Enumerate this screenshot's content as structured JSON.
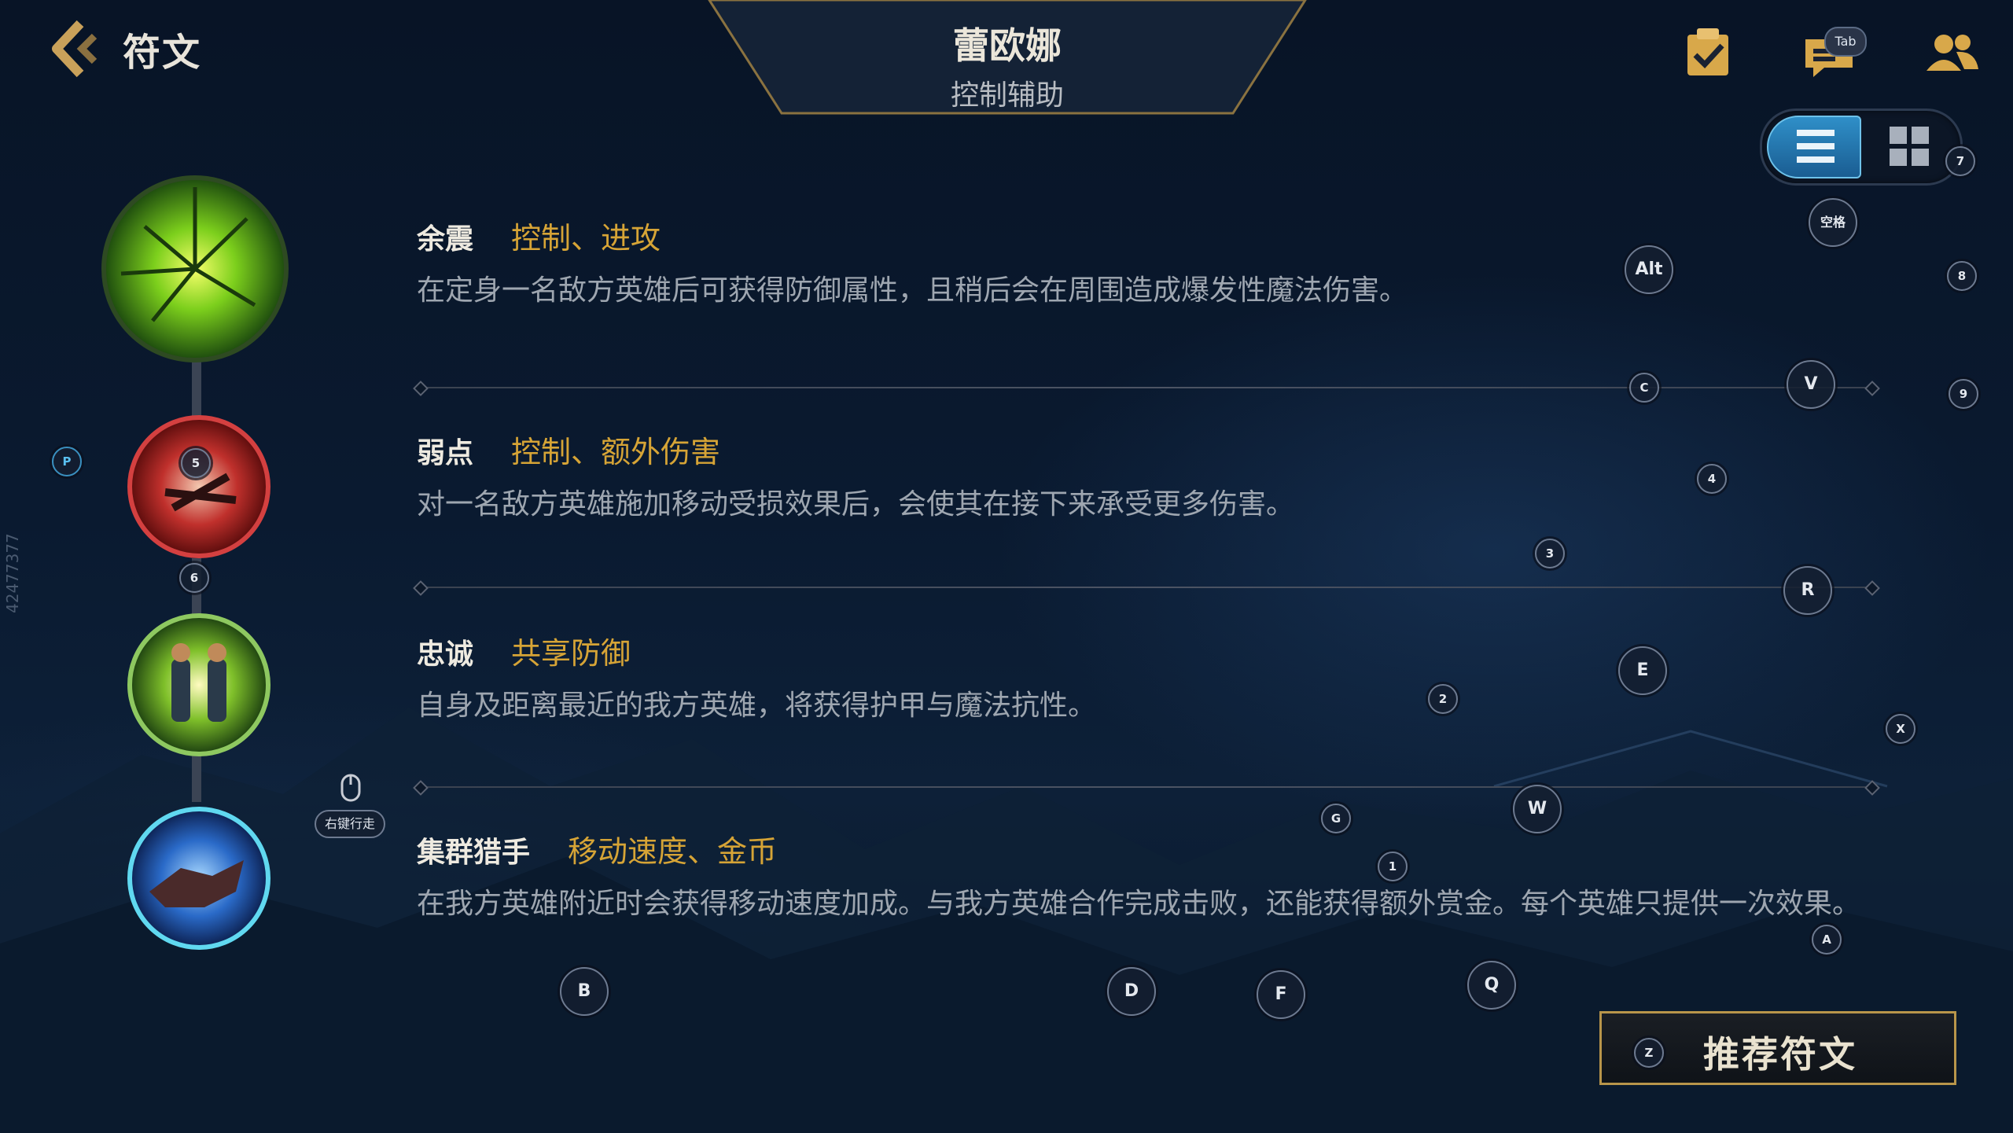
{
  "header": {
    "back_title": "符文",
    "champion_name": "蕾欧娜",
    "champion_role": "控制辅助",
    "tab_badge": "Tab"
  },
  "colors": {
    "tag_gold": "#d6a436",
    "accent_blue": "#2f8fc8",
    "button_border": "#b8954a"
  },
  "runes": [
    {
      "name": "余震",
      "tags": "控制、进攻",
      "desc": "在定身一名敌方英雄后可获得防御属性，且稍后会在周围造成爆发性魔法伤害。",
      "icon": "aftershock-icon"
    },
    {
      "name": "弱点",
      "tags": "控制、额外伤害",
      "desc": "对一名敌方英雄施加移动受损效果后，会使其在接下来承受更多伤害。",
      "icon": "weakness-icon"
    },
    {
      "name": "忠诚",
      "tags": "共享防御",
      "desc": "自身及距离最近的我方英雄，将获得护甲与魔法抗性。",
      "icon": "loyalty-icon"
    },
    {
      "name": "集群猎手",
      "tags": "移动速度、金币",
      "desc": "在我方英雄附近时会获得移动速度加成。与我方英雄合作完成击败，还能获得额外赏金。每个英雄只提供一次效果。",
      "icon": "pack-hunter-icon"
    }
  ],
  "recommend_button": "推荐符文",
  "right_click_hint": "右键行走",
  "side_id": "42477377",
  "keys": {
    "p": "P",
    "alt": "Alt",
    "space": "空格",
    "seven": "7",
    "eight": "8",
    "nine": "9",
    "c": "C",
    "v": "V",
    "four": "4",
    "five": "5",
    "six": "6",
    "three": "3",
    "r": "R",
    "e": "E",
    "two": "2",
    "x": "X",
    "g": "G",
    "w": "W",
    "one": "1",
    "a": "A",
    "b": "B",
    "d": "D",
    "f": "F",
    "q": "Q",
    "z": "Z"
  }
}
